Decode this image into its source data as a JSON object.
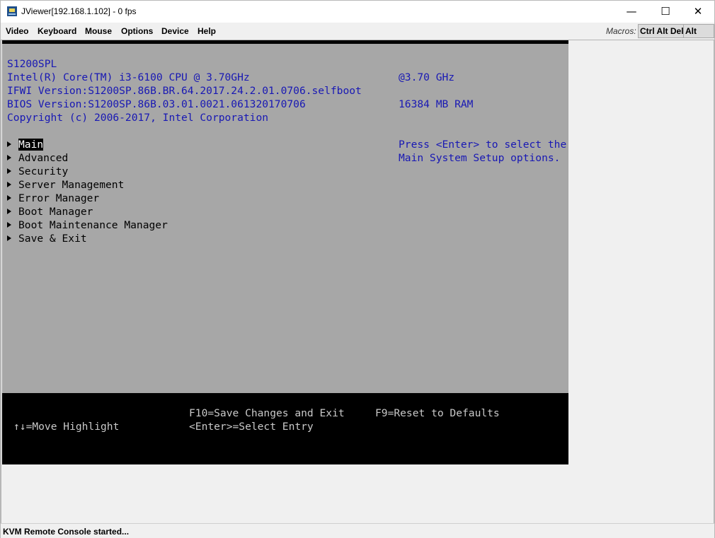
{
  "window": {
    "title": "JViewer[192.168.1.102] - 0 fps",
    "controls": {
      "minimize": "—",
      "maximize": "☐",
      "close": "✕"
    }
  },
  "menubar": {
    "items": [
      "Video",
      "Keyboard",
      "Mouse",
      "Options",
      "Device",
      "Help"
    ],
    "macros_label": "Macros:",
    "macro_buttons": [
      "Ctrl Alt Del",
      "Alt Tab"
    ]
  },
  "bios": {
    "board": "S1200SPL",
    "cpu": "Intel(R) Core(TM) i3-6100 CPU @ 3.70GHz",
    "cpu_speed": "@3.70 GHz",
    "ifwi": "IFWI Version:S1200SP.86B.BR.64.2017.24.2.01.0706.selfboot",
    "bios_version": "BIOS Version:S1200SP.86B.03.01.0021.061320170706",
    "ram": "16384 MB RAM",
    "copyright": "Copyright (c) 2006-2017, Intel Corporation",
    "menu": [
      "Main",
      "Advanced",
      "Security",
      "Server Management",
      "Error Manager",
      "Boot Manager",
      "Boot Maintenance Manager",
      "Save & Exit"
    ],
    "selected_index": 0,
    "help_line1": "Press <Enter> to select the",
    "help_line2": "Main System Setup options.",
    "footer": {
      "move": "↑↓=Move Highlight",
      "f10": "F10=Save Changes and Exit",
      "enter": "<Enter>=Select Entry",
      "f9": "F9=Reset to Defaults"
    }
  },
  "status": "KVM Remote Console started...",
  "colors": {
    "bios_background": "#a7a7a7",
    "bios_text_blue": "#1818b4",
    "help_bar": "#000000"
  }
}
